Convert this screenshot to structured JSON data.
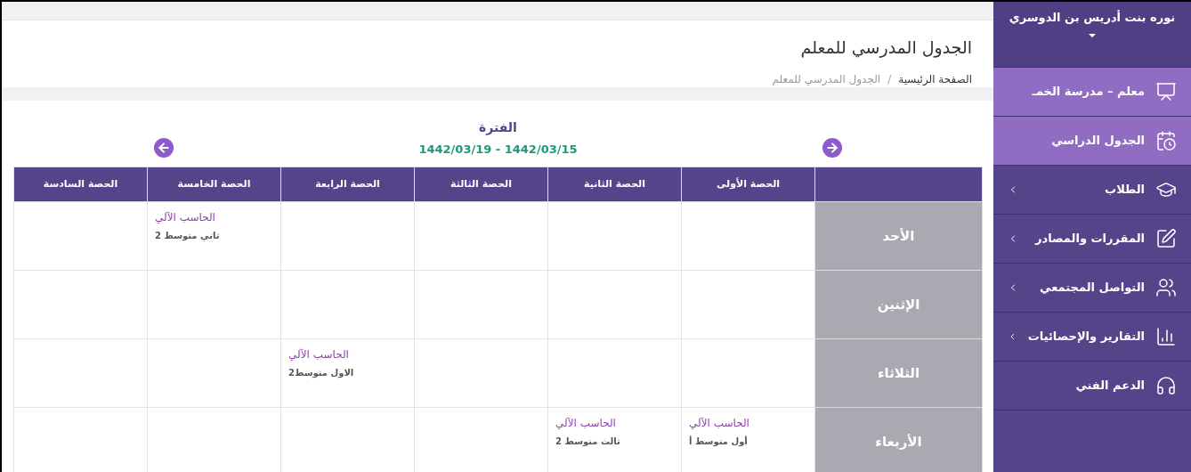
{
  "header": {
    "title": "الجدول المدرسي للمعلم",
    "breadcrumb_separator": "/",
    "breadcrumb": [
      {
        "label": "الصفحة الرئيسية",
        "current": false
      },
      {
        "label": "الجدول المدرسي للمعلم",
        "current": true
      }
    ]
  },
  "period": {
    "label": "الفترة",
    "range": "1442/03/19 - 1442/03/15"
  },
  "table": {
    "columns": [
      "الحصة الأولى",
      "الحصة الثانية",
      "الحصة الثالثة",
      "الحصة الرابعة",
      "الحصة الخامسة",
      "الحصة السادسة"
    ],
    "rows": [
      {
        "day": "الأحد",
        "cells": [
          {},
          {},
          {},
          {},
          {
            "subject": "الحاسب الآلي",
            "class": "ثاني متوسط 2"
          },
          {}
        ]
      },
      {
        "day": "الإثنين",
        "cells": [
          {},
          {},
          {},
          {},
          {},
          {}
        ]
      },
      {
        "day": "الثلاثاء",
        "cells": [
          {},
          {},
          {},
          {
            "subject": "الحاسب الآلي",
            "class": "الاول متوسط2"
          },
          {},
          {}
        ]
      },
      {
        "day": "الأربعاء",
        "cells": [
          {
            "subject": "الحاسب الآلي",
            "class": "أول متوسط أ"
          },
          {
            "subject": "الحاسب الآلي",
            "class": "ثالث متوسط 2"
          },
          {},
          {},
          {},
          {}
        ]
      }
    ]
  },
  "sidebar": {
    "user": "نوره بنت أدريس بن الدوسري",
    "items": [
      {
        "kind": "role",
        "label": "معلم – مدرسة الخمـ",
        "selected": true,
        "has_submenu": false
      },
      {
        "kind": "schedule",
        "label": "الجدول الدراسي",
        "selected": true,
        "has_submenu": false
      },
      {
        "kind": "students",
        "label": "الطلاب",
        "selected": false,
        "has_submenu": true
      },
      {
        "kind": "courses",
        "label": "المقررات والمصادر",
        "selected": false,
        "has_submenu": true
      },
      {
        "kind": "social",
        "label": "التواصل المجتمعي",
        "selected": false,
        "has_submenu": true
      },
      {
        "kind": "reports",
        "label": "التقارير والإحصائيات",
        "selected": false,
        "has_submenu": true
      },
      {
        "kind": "support",
        "label": "الدعم الفني",
        "selected": false,
        "has_submenu": false
      }
    ]
  }
}
